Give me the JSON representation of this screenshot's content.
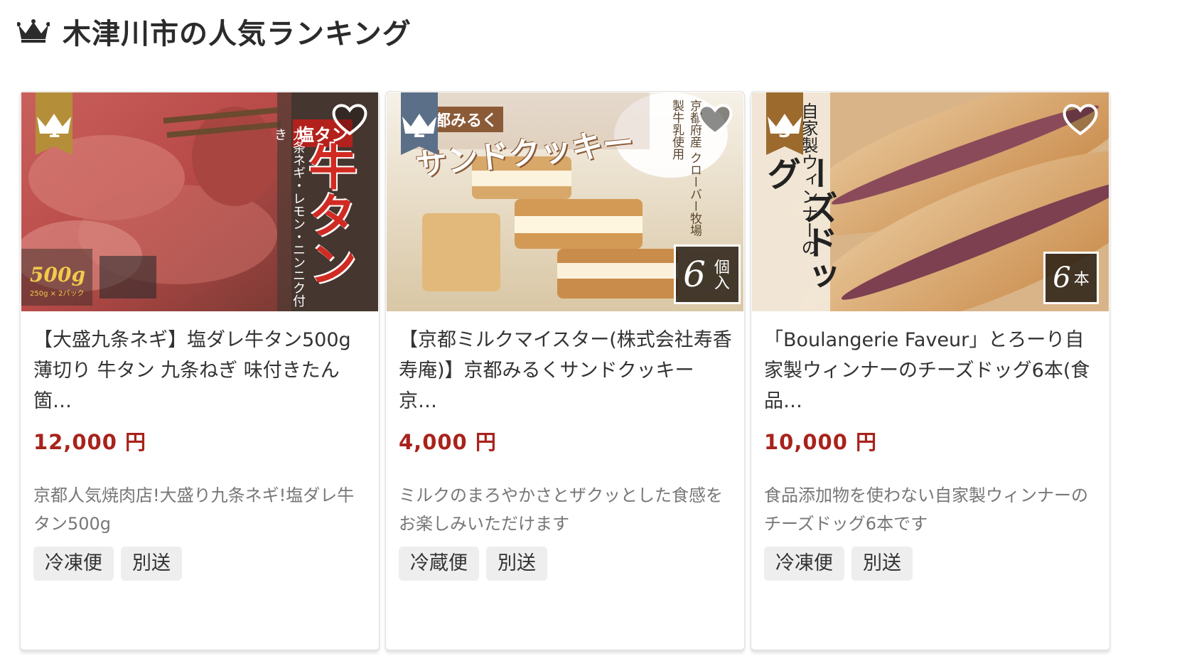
{
  "section": {
    "title": "木津川市の人気ランキング",
    "icon": "crown-icon"
  },
  "colors": {
    "price": "#a8231c",
    "rank_1": "#b58e3a",
    "rank_2": "#5b6f88",
    "rank_3": "#9c6a2c"
  },
  "cards": [
    {
      "rank": "1",
      "title": "【大盛九条ネギ】塩ダレ牛タン500g 薄切り 牛タン 九条ねぎ 味付きたん 箇…",
      "price": "12,000 円",
      "description": "京都人気焼肉店!大盛り九条ネギ!塩ダレ牛タン500g",
      "tags": [
        "冷凍便",
        "別送"
      ],
      "image": {
        "heading_small": "塩タン",
        "heading_big": "牛タン",
        "vertical_text": "九条ネギ・レモン・ニンニク付き",
        "weight": "500g",
        "weight_note": "250g × 2パック"
      }
    },
    {
      "rank": "2",
      "title": "【京都ミルクマイスター(株式会社寿香寿庵)】京都みるくサンドクッキー 京…",
      "price": "4,000 円",
      "description": "ミルクのまろやかさとザクッとした食感をお楽しみいただけます",
      "tags": [
        "冷蔵便",
        "別送"
      ],
      "image": {
        "heading_small": "都みるく",
        "heading_big": "サンドクッキー",
        "vertical_text": "京都府産 クローバー牧場製牛乳使用",
        "qty_num": "6",
        "qty_unit": "個入"
      }
    },
    {
      "rank": "3",
      "title": "「Boulangerie Faveur」とろーり自家製ウィンナーのチーズドッグ6本(食品…",
      "price": "10,000 円",
      "description": "食品添加物を使わない自家製ウィンナーのチーズドッグ6本です",
      "tags": [
        "冷凍便",
        "別送"
      ],
      "image": {
        "vertical_small": "自家製ウィンナーの",
        "vertical_big": "ーズドッグ",
        "qty_num": "6",
        "qty_unit": "本"
      }
    }
  ]
}
